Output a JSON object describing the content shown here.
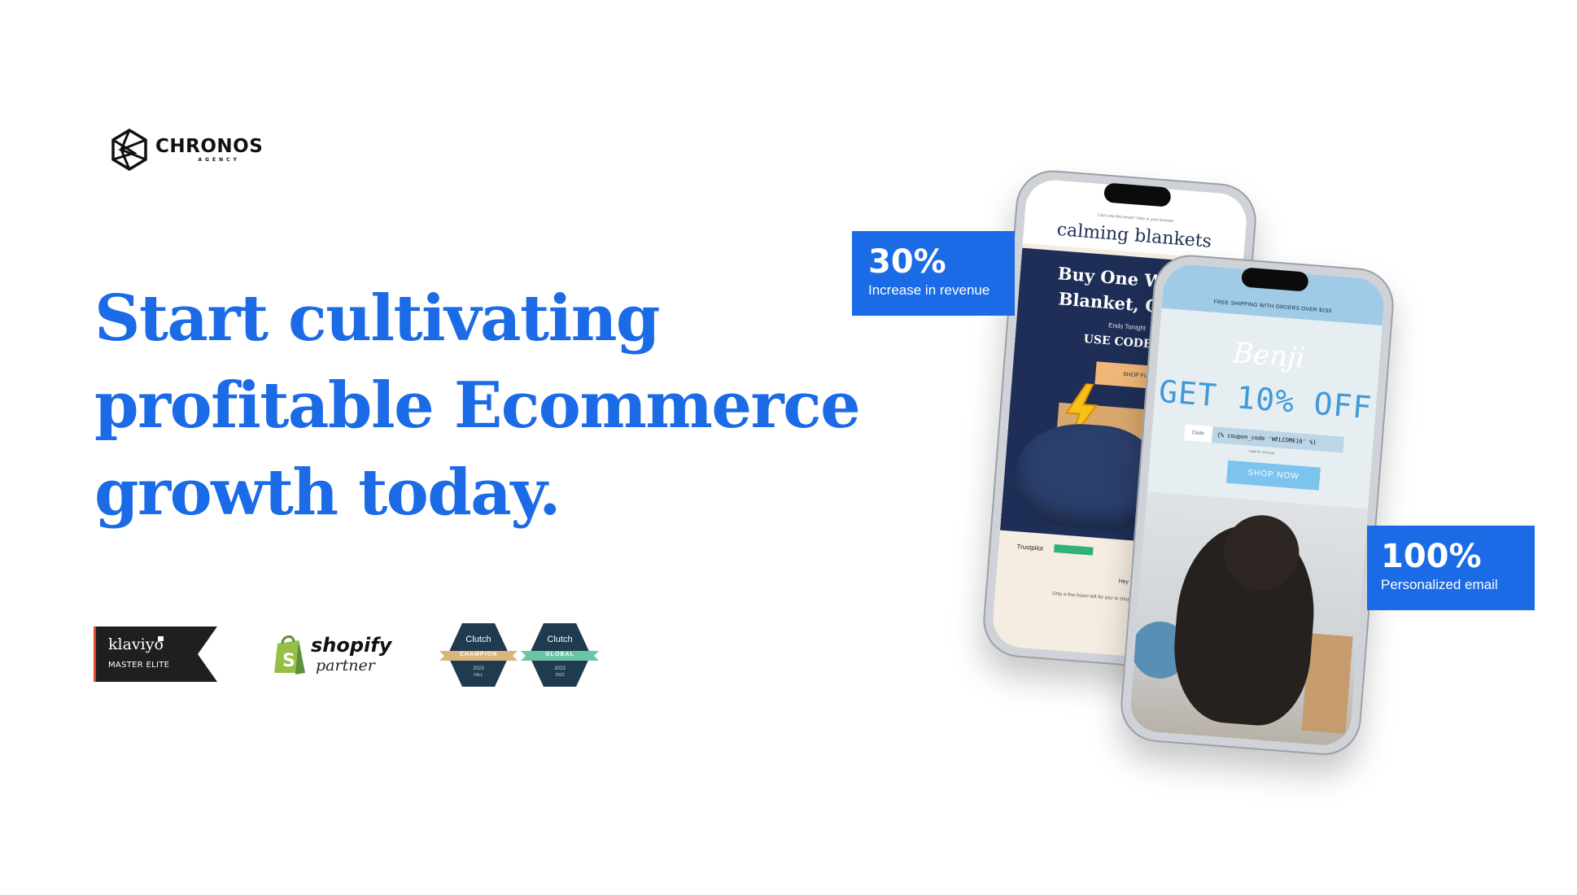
{
  "brand": {
    "name": "CHRONOS",
    "subtitle": "AGENCY"
  },
  "headline": {
    "lines": [
      "Start cultivating",
      "profitable Ecommerce",
      "growth today."
    ],
    "color": "#1b6ae6"
  },
  "badges": {
    "klaviyo": {
      "name": "klaviyo",
      "tier": "MASTER ELITE"
    },
    "shopify": {
      "name": "shopify",
      "sub": "partner"
    },
    "clutch": [
      {
        "name": "Clutch",
        "ribbon": "CHAMPION",
        "year": "2023",
        "region": "FALL"
      },
      {
        "name": "Clutch",
        "ribbon": "GLOBAL",
        "year": "2023",
        "region": "2023"
      }
    ]
  },
  "stats": [
    {
      "value": "30%",
      "label": "Increase in revenue"
    },
    {
      "value": "100%",
      "label": "Personalized email"
    }
  ],
  "phone_1": {
    "topline": "Can't see this email? View in your browser",
    "brand": "calming blankets",
    "heading_line_1": "Buy One Weigh",
    "heading_line_2": "Blanket, Get O",
    "ends": "Ends Tonight",
    "code": "USE CODE: F",
    "button": "SHOP FLASH S",
    "trust": "Trustpilot",
    "greeting": "Hey",
    "body": "Only a few hours left for you to shop the site and get a"
  },
  "phone_2": {
    "banner": "FREE SHIPPING WITH ORDERS OVER $150",
    "brand": "Benji",
    "offer": "GET 10% OFF",
    "code_label": "Code:",
    "code_value": "{% coupon_code 'WELCOME10' %}",
    "valid": "*valid for 24 hours",
    "button": "SHOP NOW"
  },
  "colors": {
    "accent": "#1b6ae6",
    "klaviyo_bg": "#1f1f1f",
    "klaviyo_accent": "#e2472a",
    "shopify_green": "#95bf47",
    "clutch_navy": "#1f3b4d",
    "clutch_gold": "#d8b57a",
    "clutch_teal": "#6cc4a8"
  }
}
